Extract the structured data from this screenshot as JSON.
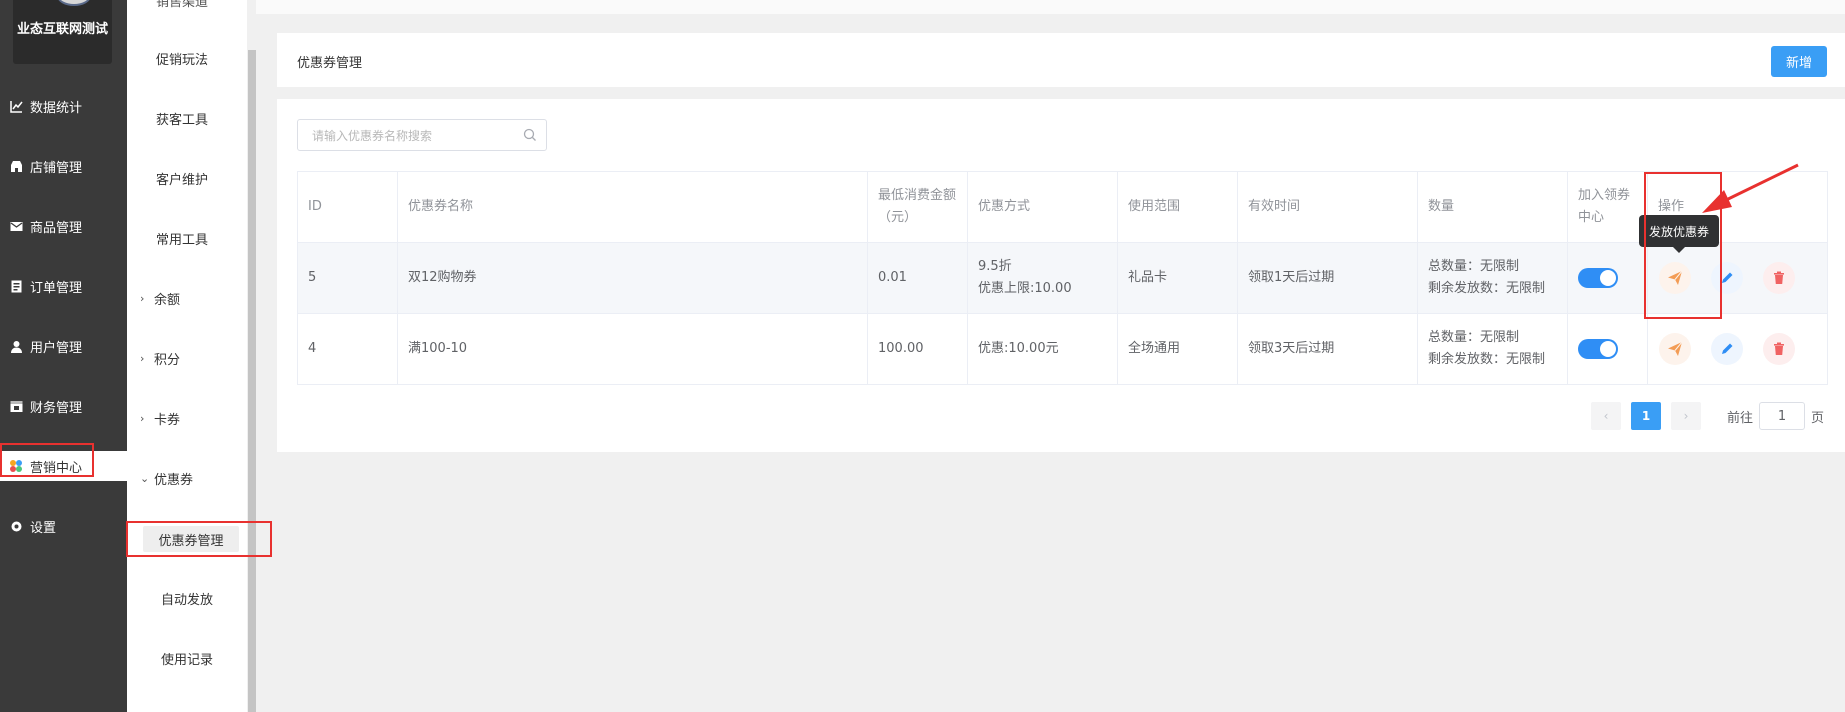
{
  "brand": {
    "name": "业态互联网测试"
  },
  "sidebar": {
    "items": [
      {
        "label": "数据统计",
        "icon": "line-chart-icon"
      },
      {
        "label": "店铺管理",
        "icon": "store-icon"
      },
      {
        "label": "商品管理",
        "icon": "mail-icon"
      },
      {
        "label": "订单管理",
        "icon": "order-icon"
      },
      {
        "label": "用户管理",
        "icon": "user-icon"
      },
      {
        "label": "财务管理",
        "icon": "finance-icon"
      },
      {
        "label": "营销中心",
        "icon": "marketing-icon",
        "active": true
      },
      {
        "label": "设置",
        "icon": "gear-icon"
      }
    ]
  },
  "subnav": {
    "partial_top": "销售渠道",
    "items": [
      {
        "label": "促销玩法"
      },
      {
        "label": "获客工具"
      },
      {
        "label": "客户维护"
      },
      {
        "label": "常用工具"
      }
    ],
    "groups": [
      {
        "label": "余额"
      },
      {
        "label": "积分"
      },
      {
        "label": "卡券"
      },
      {
        "label": "优惠券"
      }
    ],
    "children": [
      {
        "label": "优惠券管理",
        "active": true
      },
      {
        "label": "自动发放"
      },
      {
        "label": "使用记录"
      }
    ]
  },
  "header": {
    "title": "优惠券管理",
    "add_label": "新增"
  },
  "search": {
    "placeholder": "请输入优惠券名称搜索",
    "value": ""
  },
  "table": {
    "columns": [
      "ID",
      "优惠券名称",
      "最低消费金额（元）",
      "优惠方式",
      "使用范围",
      "有效时间",
      "数量",
      "加入领券中心",
      "操作"
    ],
    "rows": [
      {
        "id": "5",
        "name": "双12购物券",
        "min_amount": "0.01",
        "discount_line1": "9.5折",
        "discount_line2": "优惠上限:10.00",
        "scope": "礼品卡",
        "validity": "领取1天后过期",
        "qty_total": "总数量：无限制",
        "qty_remaining": "剩余发放数：无限制",
        "in_center": true
      },
      {
        "id": "4",
        "name": "满100-10",
        "min_amount": "100.00",
        "discount_line1": "优惠:10.00元",
        "discount_line2": "",
        "scope": "全场通用",
        "validity": "领取3天后过期",
        "qty_total": "总数量：无限制",
        "qty_remaining": "剩余发放数：无限制",
        "in_center": true
      }
    ]
  },
  "tooltip": {
    "text": "发放优惠券"
  },
  "pagination": {
    "prev": "‹",
    "current": "1",
    "next": "›",
    "goto_prefix": "前往",
    "goto_value": "1",
    "goto_suffix": "页"
  },
  "colors": {
    "primary": "#3a9ef5",
    "sidebar": "#3a3a3a",
    "annotation": "#e8312f",
    "send": "#f39c55",
    "edit": "#2f8ef5",
    "delete": "#f06262"
  }
}
